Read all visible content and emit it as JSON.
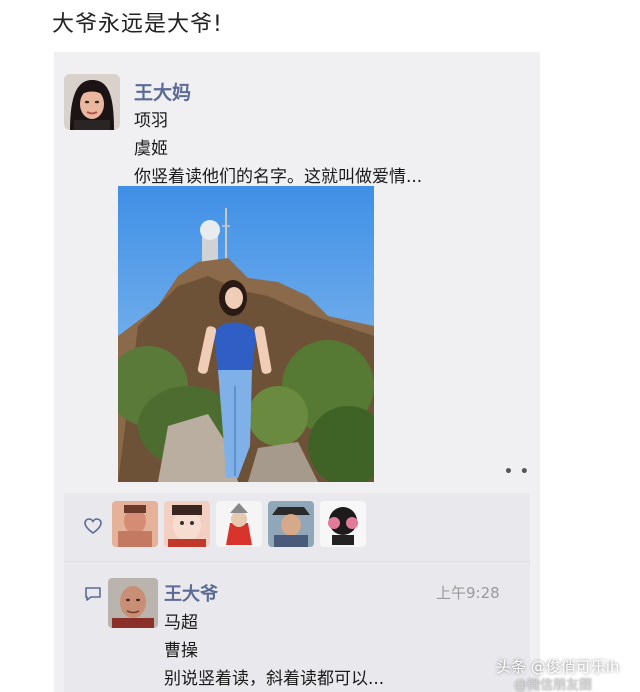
{
  "post": {
    "title": "大爷永远是大爷!"
  },
  "moment": {
    "author": "王大妈",
    "lines": [
      "项羽",
      "虞姬",
      "你竖着读他们的名字。这就叫做爱情..."
    ],
    "more_icon": "more-dots-icon"
  },
  "likes": {
    "icon": "heart-icon",
    "count_avatars": 5
  },
  "comment": {
    "author": "王大爷",
    "time": "上午9:28",
    "lines": [
      "马超",
      "曹操",
      "别说竖着读，斜着读都可以..."
    ],
    "icon": "comment-bubble-icon"
  },
  "watermark": {
    "primary": "头条 @俊俏可乐ih",
    "secondary": "@微信朋友圈"
  },
  "colors": {
    "name": "#5b6b93",
    "card_bg": "#f0eff2",
    "likes_bg": "#e9e8ec",
    "sky": "#6aa9e8"
  }
}
